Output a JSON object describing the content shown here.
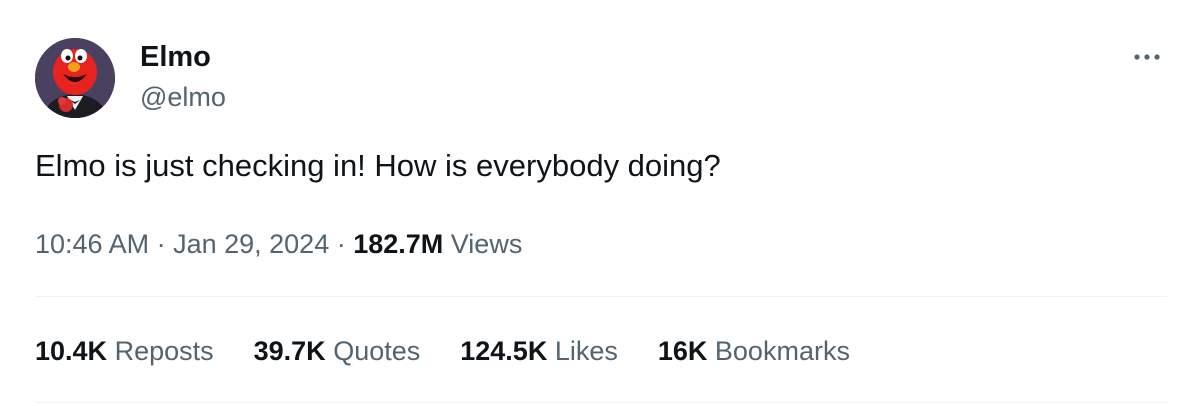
{
  "author": {
    "display_name": "Elmo",
    "handle": "@elmo"
  },
  "tweet": {
    "text": "Elmo is just checking in! How is everybody doing?",
    "time": "10:46 AM",
    "separator1": " · ",
    "date": "Jan 29, 2024",
    "separator2": " · ",
    "views_count": "182.7M",
    "views_label": " Views"
  },
  "stats": {
    "reposts": {
      "count": "10.4K",
      "label": " Reposts"
    },
    "quotes": {
      "count": "39.7K",
      "label": " Quotes"
    },
    "likes": {
      "count": "124.5K",
      "label": " Likes"
    },
    "bookmarks": {
      "count": "16K",
      "label": " Bookmarks"
    }
  },
  "icons": {
    "more": "more-horizontal-icon"
  },
  "colors": {
    "primary_text": "#0f1419",
    "secondary_text": "#536471",
    "divider": "#eff3f4",
    "background": "#ffffff"
  }
}
